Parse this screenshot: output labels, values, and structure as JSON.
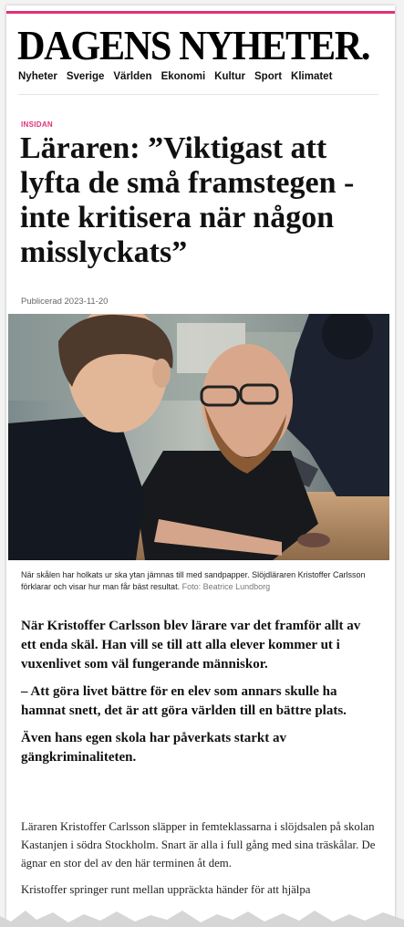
{
  "site": {
    "name": "DAGENS NYHETER."
  },
  "nav": {
    "items": [
      "Nyheter",
      "Sverige",
      "Världen",
      "Ekonomi",
      "Kultur",
      "Sport",
      "Klimatet"
    ]
  },
  "article": {
    "kicker": "INSIDAN",
    "headline": "Läraren: ”Viktigast att lyfta de små framstegen - inte kritisera när någon misslyckats”",
    "published": "Publicerad 2023-11-20",
    "photo": {
      "description_icon": "photo-icon"
    },
    "caption": "När skålen har holkats ur ska ytan jämnas till med sandpapper. Slöjdläraren Kristoffer Carlsson förklarar och visar hur man får bäst resultat.",
    "credit": "Foto: Beatrice Lundborg",
    "lead": [
      "När Kristoffer Carlsson blev lärare var det framför allt av ett enda skäl. Han vill se till att alla elever kommer ut i vuxenlivet som väl fungerande människor.",
      "– Att göra livet bättre för en elev som annars skulle ha hamnat snett, det är att göra världen till en bättre plats.",
      "Även hans egen skola har påverkats starkt av gängkriminaliteten."
    ],
    "body": [
      "Läraren Kristoffer Carlsson släpper in femteklassarna i slöjdsalen på skolan Kastanjen i södra Stockholm. Snart är alla i full gång med sina träskålar. De ägnar en stor del av den här terminen åt dem.",
      "Kristoffer springer runt mellan uppräckta händer för att hjälpa"
    ]
  },
  "colors": {
    "accent": "#e2307a",
    "text": "#111111"
  }
}
